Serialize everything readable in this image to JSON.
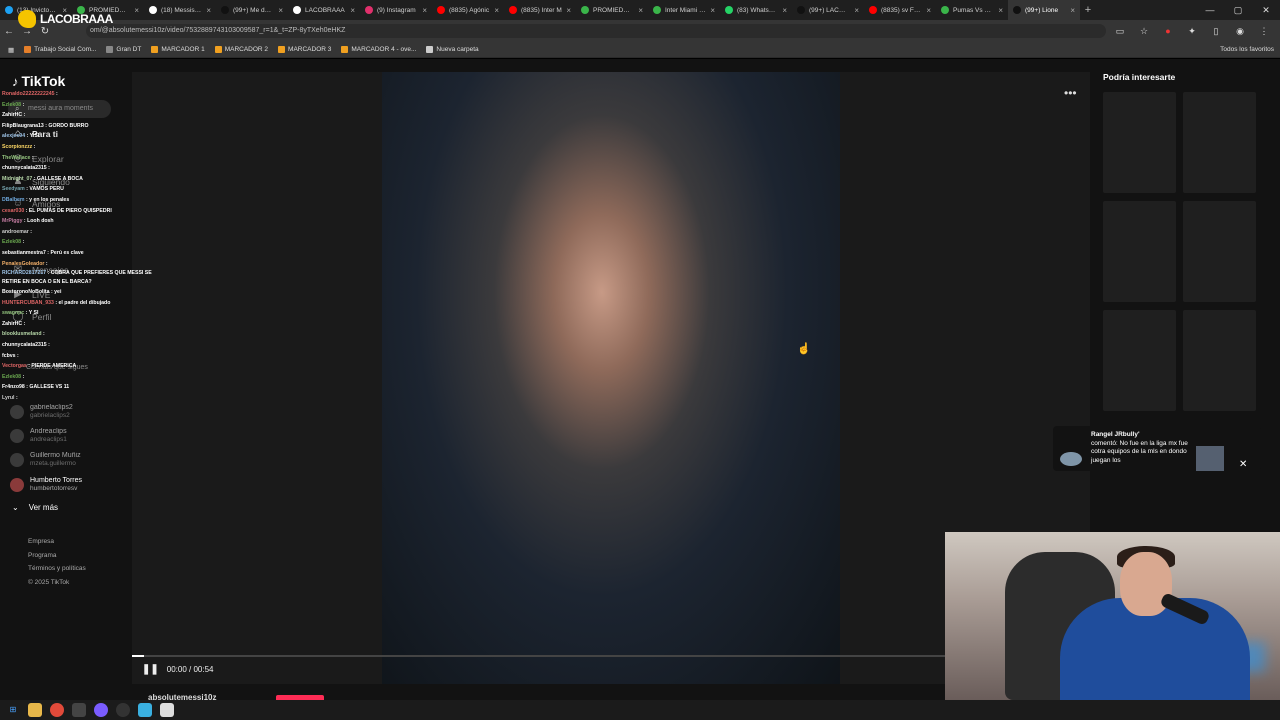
{
  "browser": {
    "tabs": [
      {
        "label": "(13) Invictos en",
        "color": "#1da1f2"
      },
      {
        "label": "PROMIEDOS -",
        "color": "#3ab54a"
      },
      {
        "label": "(18) Messismo",
        "color": "#ffffff"
      },
      {
        "label": "(99+) Me duele",
        "color": "#111111"
      },
      {
        "label": "LACOBRAAA",
        "color": "#ffffff"
      },
      {
        "label": "(9) Instagram",
        "color": "#e1306c"
      },
      {
        "label": "(8835) Agónic",
        "color": "#ff0000"
      },
      {
        "label": "(8835) Inter M",
        "color": "#ff0000"
      },
      {
        "label": "PROMIEDOS -",
        "color": "#3ab54a"
      },
      {
        "label": "Inter Miami Vs",
        "color": "#3ab54a"
      },
      {
        "label": "(83) WhatsApp",
        "color": "#25d366"
      },
      {
        "label": "(99+) LACOBRA",
        "color": "#111111"
      },
      {
        "label": "(8835) sv Fútbo",
        "color": "#ff0000"
      },
      {
        "label": "Pumas Vs Orla",
        "color": "#3ab54a"
      },
      {
        "label": "(99+) Lione",
        "color": "#111111"
      }
    ],
    "url": "om/@absolutemessi10z/video/7532889743103009587_r=1&_t=ZP-8yTXeh0eHKZ",
    "bookmarks": [
      {
        "label": "Trabajo Social Com...",
        "color": "#e57f2a"
      },
      {
        "label": "Gran DT",
        "color": "#888888"
      },
      {
        "label": "MARCADOR 1",
        "color": "#f0a020"
      },
      {
        "label": "MARCADOR 2",
        "color": "#f0a020"
      },
      {
        "label": "MARCADOR 3",
        "color": "#f0a020"
      },
      {
        "label": "MARCADOR 4 - ove...",
        "color": "#f0a020"
      },
      {
        "label": "Nueva carpeta",
        "color": "#cccccc"
      }
    ],
    "bookmarks_right": "Todos los favoritos"
  },
  "stream_logo": "LACOBRAAA",
  "tiktok": {
    "logo": "TikTok",
    "search_placeholder": "messi aura moments",
    "nav": [
      {
        "label": "Para ti",
        "icon": "home-icon"
      },
      {
        "label": "Explorar",
        "icon": "compass-icon"
      },
      {
        "label": "Siguiendo",
        "icon": "following-icon"
      },
      {
        "label": "Amigos",
        "icon": "friends-icon"
      },
      {
        "label": "LIVE",
        "icon": "live-icon"
      },
      {
        "label": "Mensajes",
        "icon": "message-icon"
      },
      {
        "label": "Perfil",
        "icon": "profile-icon"
      }
    ],
    "following_title": "Cuentas que sigues",
    "following": [
      {
        "name": "gabrielaclips2",
        "handle": "gabrielaclips2"
      },
      {
        "name": "Andreaclips",
        "handle": "andreaclips1"
      },
      {
        "name": "Guillermo Muñiz",
        "handle": "mzeta.guillermo"
      },
      {
        "name": "Humberto Torres",
        "handle": "humbertotorresv"
      }
    ],
    "ver_mas": "Ver más",
    "footer": [
      "Empresa",
      "Programa",
      "Términos y políticas",
      "© 2025 TikTok"
    ],
    "video": {
      "time": "00:00 / 00:54",
      "author": "absolutemessi10z",
      "progress": 0.015
    },
    "right_panel_title": "Podría interesarte"
  },
  "chat": [
    {
      "user": "Ronaldo22222222245",
      "msg": ":",
      "color": "#e06666"
    },
    {
      "user": "Ezlek08",
      "msg": ":",
      "color": "#6aa84f"
    },
    {
      "user": "ZahirHC",
      "msg": ":",
      "color": "#ffffff"
    },
    {
      "user": "FilipBlaugrana13",
      "msg": ": GORDO BURRO",
      "color": "#ffffff"
    },
    {
      "user": "alexjes94",
      "msg": ": Y SI",
      "color": "#9fc5e8"
    },
    {
      "user": "Scorpionzzz",
      "msg": ":",
      "color": "#ffd966"
    },
    {
      "user": "TheWallace",
      "msg": ":",
      "color": "#93c47d"
    },
    {
      "user": "chunnycalata2315",
      "msg": ":",
      "color": "#ffffff"
    },
    {
      "user": "Midnight_07",
      "msg": ": GALLESE A BOCA",
      "color": "#b6d7a8"
    },
    {
      "user": "Seedyam",
      "msg": ": VAMOS PERU",
      "color": "#76a5af"
    },
    {
      "user": "DBalbem",
      "msg": ": y en los penales",
      "color": "#6fa8dc"
    },
    {
      "user": "cesar030",
      "msg": ": EL PUMAS DE PIERO QUISPEDRI",
      "color": "#e06666"
    },
    {
      "user": "MrPiggy",
      "msg": ": Looh dosh",
      "color": "#c27ba0"
    },
    {
      "user": "androemar",
      "msg": ":",
      "color": "#cccccc"
    },
    {
      "user": "Ezlek08",
      "msg": ":",
      "color": "#6aa84f"
    },
    {
      "user": "sebastianmestra7",
      "msg": ": Perú es clave",
      "color": "#ffffff"
    },
    {
      "user": "PenalesGoleador",
      "msg": ":",
      "color": "#f6b26b"
    },
    {
      "user": "RICHARD2817217",
      "msg": ": COBRA QUE PREFIERES QUE MESSI SE RETIRE EN BOCA O EN EL BARCA?",
      "color": "#9fc5e8"
    },
    {
      "user": "BostoronoNoBolita",
      "msg": ": yei",
      "color": "#ffffff"
    },
    {
      "user": "HUNTERCUBAN_933",
      "msg": ": el padre del dibujado",
      "color": "#e06666"
    },
    {
      "user": "swagnpc",
      "msg": ": Y SI",
      "color": "#93c47d"
    },
    {
      "user": "ZahirHC",
      "msg": ":",
      "color": "#ffffff"
    },
    {
      "user": "blooklusmeland",
      "msg": ":",
      "color": "#b6d7a8"
    },
    {
      "user": "chunnycalata2315",
      "msg": ":",
      "color": "#ffffff"
    },
    {
      "user": "fcbvs",
      "msg": ":",
      "color": "#ffffff"
    },
    {
      "user": "Vectorgas",
      "msg": ": PIERDE AMERICA",
      "color": "#e06666"
    },
    {
      "user": "Ezlek08",
      "msg": ":",
      "color": "#6aa84f"
    },
    {
      "user": "Fr4nzo98",
      "msg": ": GALLESE VS 11",
      "color": "#ffffff"
    },
    {
      "user": "Lyrul",
      "msg": ":",
      "color": "#cccccc"
    }
  ],
  "notification": {
    "user": "Rangel JRbully'",
    "text": "comentó: No fue en la liga mx fue cotra equipos de la mls en dondo juegan los"
  }
}
